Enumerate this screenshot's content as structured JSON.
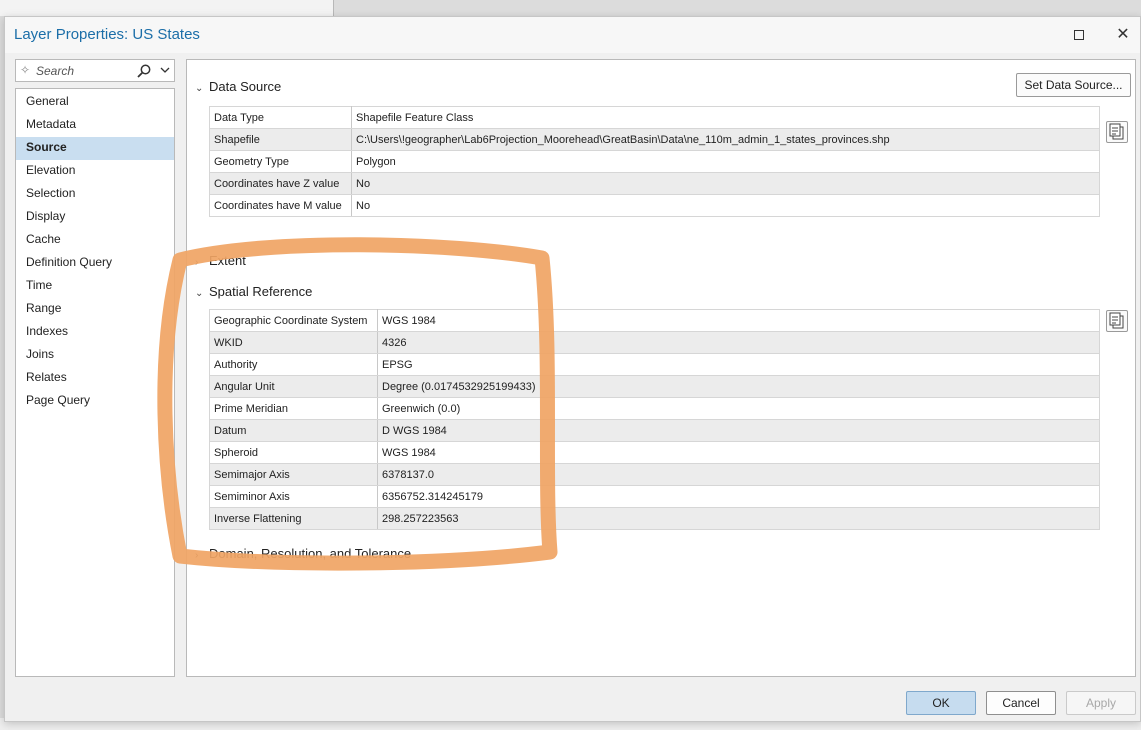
{
  "window": {
    "title": "Layer Properties: US States"
  },
  "search": {
    "placeholder": "Search"
  },
  "nav": {
    "items": [
      {
        "label": "General"
      },
      {
        "label": "Metadata"
      },
      {
        "label": "Source",
        "selected": true
      },
      {
        "label": "Elevation"
      },
      {
        "label": "Selection"
      },
      {
        "label": "Display"
      },
      {
        "label": "Cache"
      },
      {
        "label": "Definition Query"
      },
      {
        "label": "Time"
      },
      {
        "label": "Range"
      },
      {
        "label": "Indexes"
      },
      {
        "label": "Joins"
      },
      {
        "label": "Relates"
      },
      {
        "label": "Page Query"
      }
    ]
  },
  "data_source": {
    "heading": "Data Source",
    "set_button": "Set Data Source...",
    "rows": [
      {
        "key": "Data Type",
        "value": "Shapefile Feature Class"
      },
      {
        "key": "Shapefile",
        "value": "C:\\Users\\!geographer\\Lab6Projection_Moorehead\\GreatBasin\\Data\\ne_110m_admin_1_states_provinces.shp"
      },
      {
        "key": "Geometry Type",
        "value": "Polygon"
      },
      {
        "key": "Coordinates have Z value",
        "value": "No"
      },
      {
        "key": "Coordinates have M value",
        "value": "No"
      }
    ]
  },
  "extent": {
    "heading": "Extent"
  },
  "spatial_reference": {
    "heading": "Spatial Reference",
    "rows": [
      {
        "key": "Geographic Coordinate System",
        "value": "WGS 1984"
      },
      {
        "key": "WKID",
        "value": "4326"
      },
      {
        "key": "Authority",
        "value": "EPSG"
      },
      {
        "key": "Angular Unit",
        "value": "Degree (0.0174532925199433)"
      },
      {
        "key": "Prime Meridian",
        "value": "Greenwich (0.0)"
      },
      {
        "key": "Datum",
        "value": "D WGS 1984"
      },
      {
        "key": "Spheroid",
        "value": "WGS 1984"
      },
      {
        "key": "Semimajor Axis",
        "value": "6378137.0"
      },
      {
        "key": "Semiminor Axis",
        "value": "6356752.314245179"
      },
      {
        "key": "Inverse Flattening",
        "value": "298.257223563"
      }
    ]
  },
  "domain": {
    "heading": "Domain, Resolution, and Tolerance"
  },
  "footer": {
    "ok": "OK",
    "cancel": "Cancel",
    "apply": "Apply"
  },
  "colors": {
    "accent": "#1b6ea8",
    "selection": "#c9def0",
    "annotation": "#f0a464"
  }
}
